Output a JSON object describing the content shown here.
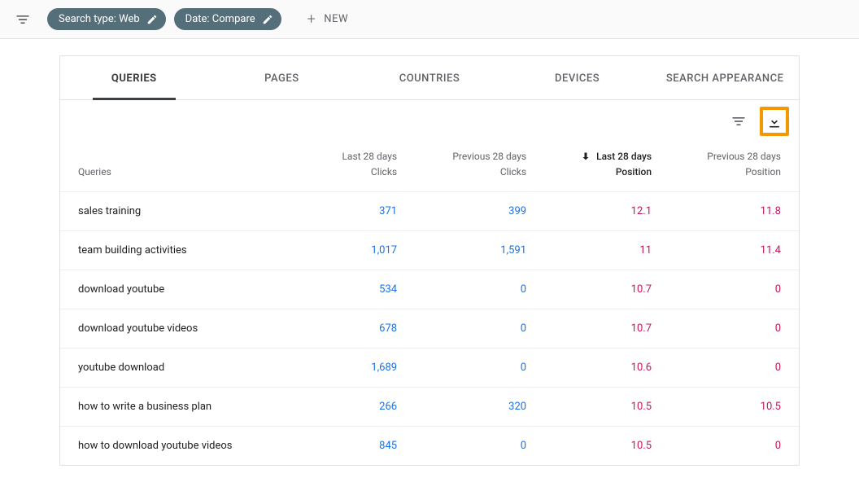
{
  "toolbar": {
    "chip_search_type": "Search type: Web",
    "chip_date": "Date: Compare",
    "new_label": "NEW"
  },
  "tabs": [
    {
      "label": "QUERIES",
      "active": true
    },
    {
      "label": "PAGES",
      "active": false
    },
    {
      "label": "COUNTRIES",
      "active": false
    },
    {
      "label": "DEVICES",
      "active": false
    },
    {
      "label": "SEARCH APPEARANCE",
      "active": false
    }
  ],
  "table": {
    "columns": {
      "queries": "Queries",
      "c1_line1": "Last 28 days",
      "c1_line2": "Clicks",
      "c2_line1": "Previous 28 days",
      "c2_line2": "Clicks",
      "c3_line1": "Last 28 days",
      "c3_line2": "Position",
      "c4_line1": "Previous 28 days",
      "c4_line2": "Position"
    },
    "rows": [
      {
        "query": "sales training",
        "c1": "371",
        "c2": "399",
        "c3": "12.1",
        "c4": "11.8"
      },
      {
        "query": "team building activities",
        "c1": "1,017",
        "c2": "1,591",
        "c3": "11",
        "c4": "11.4"
      },
      {
        "query": "download youtube",
        "c1": "534",
        "c2": "0",
        "c3": "10.7",
        "c4": "0"
      },
      {
        "query": "download youtube videos",
        "c1": "678",
        "c2": "0",
        "c3": "10.7",
        "c4": "0"
      },
      {
        "query": "youtube download",
        "c1": "1,689",
        "c2": "0",
        "c3": "10.6",
        "c4": "0"
      },
      {
        "query": "how to write a business plan",
        "c1": "266",
        "c2": "320",
        "c3": "10.5",
        "c4": "10.5"
      },
      {
        "query": "how to download youtube videos",
        "c1": "845",
        "c2": "0",
        "c3": "10.5",
        "c4": "0"
      }
    ]
  }
}
